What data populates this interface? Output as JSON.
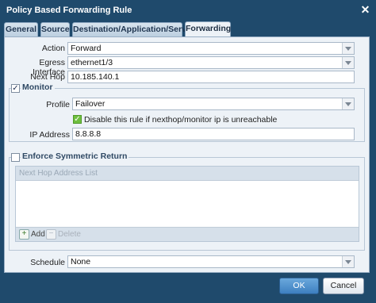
{
  "dialog": {
    "title": "Policy Based Forwarding Rule"
  },
  "tabs": [
    {
      "label": "General"
    },
    {
      "label": "Source"
    },
    {
      "label": "Destination/Application/Service"
    },
    {
      "label": "Forwarding"
    }
  ],
  "forwarding": {
    "action_label": "Action",
    "action_value": "Forward",
    "egress_label": "Egress Interface",
    "egress_value": "ethernet1/3",
    "nexthop_label": "Next Hop",
    "nexthop_value": "10.185.140.1",
    "monitor": {
      "title": "Monitor",
      "checked": true,
      "profile_label": "Profile",
      "profile_value": "Failover",
      "disable_label": "Disable this rule if nexthop/monitor ip is unreachable",
      "disable_checked": true,
      "ip_label": "IP Address",
      "ip_value": "8.8.8.8"
    },
    "symmetric": {
      "title": "Enforce Symmetric Return",
      "checked": false,
      "list_header": "Next Hop Address List",
      "add_label": "Add",
      "delete_label": "Delete"
    },
    "schedule_label": "Schedule",
    "schedule_value": "None"
  },
  "buttons": {
    "ok": "OK",
    "cancel": "Cancel"
  },
  "colors": {
    "frame": "#1f4a6c",
    "panel": "#edf2f7",
    "ok_button": "#3d7fc0"
  }
}
